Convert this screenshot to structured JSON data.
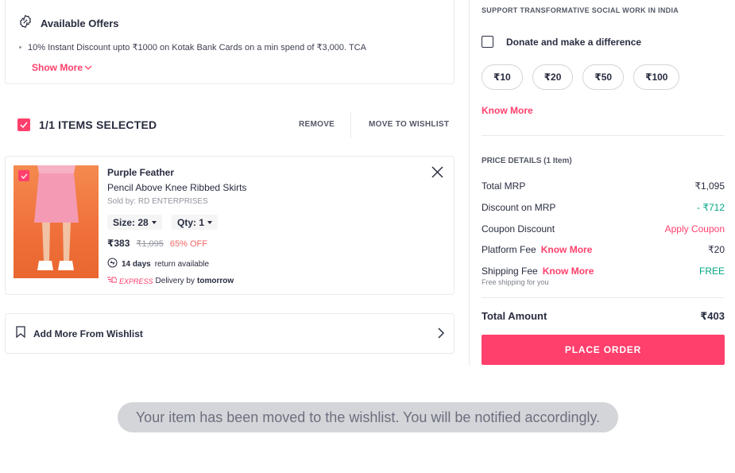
{
  "offers": {
    "title": "Available Offers",
    "line": "10% Instant Discount upto ₹1000 on Kotak Bank Cards on a min spend of ₹3,000. TCA",
    "show_more": "Show More"
  },
  "selection": {
    "count_label": "1/1 ITEMS SELECTED",
    "remove_label": "REMOVE",
    "wishlist_label": "MOVE TO WISHLIST"
  },
  "item": {
    "brand": "Purple Feather",
    "name": "Pencil Above Knee Ribbed Skirts",
    "seller": "Sold by: RD ENTERPRISES",
    "size_label": "Size: 28",
    "qty_label": "Qty: 1",
    "price": "₹383",
    "mrp": "₹1,095",
    "discount": "65% OFF",
    "return_days": "14 days",
    "return_text": "return available",
    "express_label": "EXPRESS",
    "delivery_text": "Delivery by",
    "delivery_when": "tomorrow"
  },
  "wishlist_row": {
    "label": "Add More From Wishlist"
  },
  "donation": {
    "heading": "SUPPORT TRANSFORMATIVE SOCIAL WORK IN INDIA",
    "checkbox_label": "Donate and make a difference",
    "amounts": [
      "₹10",
      "₹20",
      "₹50",
      "₹100"
    ],
    "know_more": "Know More"
  },
  "price_details": {
    "heading": "PRICE DETAILS (1 Item)",
    "total_mrp_label": "Total MRP",
    "total_mrp_value": "₹1,095",
    "discount_label": "Discount on MRP",
    "discount_value": "- ₹712",
    "coupon_label": "Coupon Discount",
    "coupon_value": "Apply Coupon",
    "platform_label": "Platform Fee",
    "platform_know": "Know More",
    "platform_value": "₹20",
    "shipping_label": "Shipping Fee",
    "shipping_know": "Know More",
    "shipping_value": "FREE",
    "shipping_sub": "Free shipping for you",
    "total_label": "Total Amount",
    "total_value": "₹403",
    "place_order": "PLACE ORDER"
  },
  "toast": {
    "message": "Your item has been moved to the wishlist. You will be notified accordingly."
  },
  "colors": {
    "accent": "#ff3f6c",
    "success": "#03a685",
    "text": "#282c3f"
  }
}
